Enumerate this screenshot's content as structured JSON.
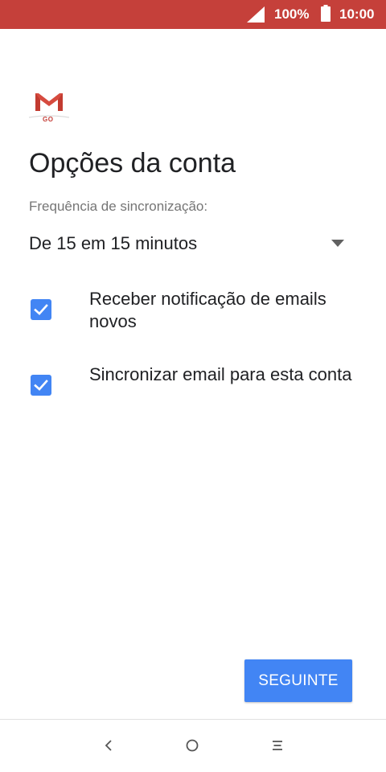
{
  "status_bar": {
    "battery_percent": "100%",
    "time": "10:00",
    "icons": [
      "signal-icon",
      "battery-icon"
    ]
  },
  "app": {
    "logo_icon": "gmail-go-icon",
    "logo_text": "GO"
  },
  "page": {
    "title": "Opções da conta"
  },
  "sync": {
    "label": "Frequência de sincronização:",
    "selected_value": "De 15 em 15 minutos",
    "arrow_icon": "dropdown-arrow-icon"
  },
  "options": [
    {
      "label": "Receber notificação de emails novos",
      "checked": true
    },
    {
      "label": "Sincronizar email para esta conta",
      "checked": true
    }
  ],
  "actions": {
    "next_label": "SEGUINTE"
  },
  "nav_bar": {
    "icons": [
      "back-icon",
      "home-icon",
      "recents-icon"
    ]
  },
  "colors": {
    "status_bar": "#c5403a",
    "accent": "#4285f4",
    "text_primary": "#202124",
    "text_secondary": "#757575"
  }
}
